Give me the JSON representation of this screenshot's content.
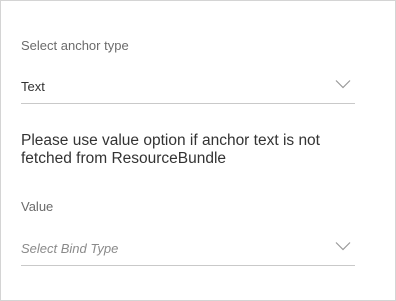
{
  "anchor_type": {
    "label": "Select anchor type",
    "value": "Text",
    "icon": "chevron-down-icon"
  },
  "info": {
    "line1": "Please use value option if anchor text is not",
    "line2": "fetched from ResourceBundle"
  },
  "value_field": {
    "label": "Value",
    "placeholder": "Select Bind Type",
    "icon": "chevron-down-icon"
  },
  "colors": {
    "label": "#6b6b6b",
    "text": "#333333",
    "placeholder": "#8a8a8a",
    "underline": "#c9c9c9",
    "border": "#d4d4d4"
  }
}
